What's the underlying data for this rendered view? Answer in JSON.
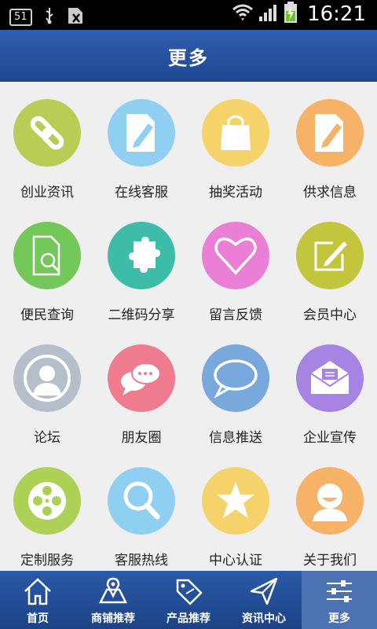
{
  "status_bar": {
    "notification_badge": "51",
    "time": "16:21"
  },
  "header": {
    "title": "更多"
  },
  "grid": {
    "items": [
      {
        "label": "创业资讯",
        "icon": "link-icon",
        "color": "#b9cd56"
      },
      {
        "label": "在线客服",
        "icon": "document-edit-icon",
        "color": "#8fd0f2"
      },
      {
        "label": "抽奖活动",
        "icon": "shopping-bag-icon",
        "color": "#f6d36a"
      },
      {
        "label": "供求信息",
        "icon": "document-edit-icon",
        "color": "#f6b267"
      },
      {
        "label": "便民查询",
        "icon": "document-search-icon",
        "color": "#74c85a"
      },
      {
        "label": "二维码分享",
        "icon": "puzzle-icon",
        "color": "#3dbcaa"
      },
      {
        "label": "留言反馈",
        "icon": "heart-icon",
        "color": "#ea7fd5"
      },
      {
        "label": "会员中心",
        "icon": "edit-box-icon",
        "color": "#c3c53d"
      },
      {
        "label": "论坛",
        "icon": "user-icon",
        "color": "#b5bfc9"
      },
      {
        "label": "朋友圈",
        "icon": "chat-icon",
        "color": "#ef7c8e"
      },
      {
        "label": "信息推送",
        "icon": "speech-bubble-icon",
        "color": "#79a8dc"
      },
      {
        "label": "企业宣传",
        "icon": "mail-icon",
        "color": "#a784e3"
      },
      {
        "label": "定制服务",
        "icon": "film-reel-icon",
        "color": "#acd154"
      },
      {
        "label": "客服热线",
        "icon": "magnifier-icon",
        "color": "#8fd0f2"
      },
      {
        "label": "中心认证",
        "icon": "star-icon",
        "color": "#f6d36a"
      },
      {
        "label": "关于我们",
        "icon": "smiley-user-icon",
        "color": "#f6b267"
      }
    ]
  },
  "tabbar": {
    "tabs": [
      {
        "label": "首页",
        "icon": "home-icon"
      },
      {
        "label": "商铺推荐",
        "icon": "map-icon"
      },
      {
        "label": "产品推荐",
        "icon": "sale-tag-icon"
      },
      {
        "label": "资讯中心",
        "icon": "send-icon"
      },
      {
        "label": "更多",
        "icon": "sliders-icon",
        "active": true
      }
    ]
  }
}
